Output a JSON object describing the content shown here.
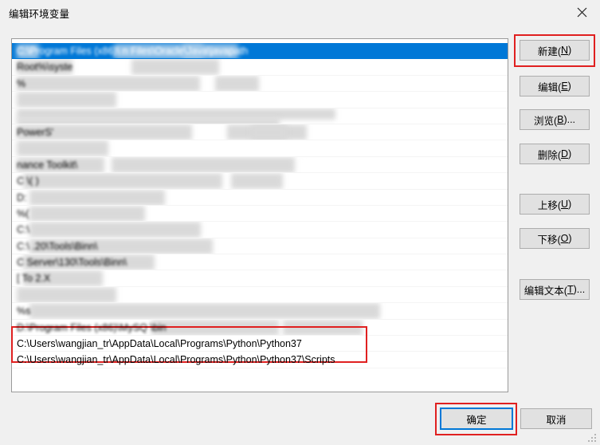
{
  "window": {
    "title": "编辑环境变量",
    "close_icon": "close-icon",
    "close_glyph": "✕"
  },
  "list": {
    "rows": [
      {
        "text": "C:\\Program Files (x86)\\            n Files\\Oracle\\Java\\javapath",
        "selected": true,
        "blur_text": true,
        "redactions": [
          [
            6,
            1,
            28,
            19
          ],
          [
            128,
            1,
            112,
            19
          ],
          [
            214,
            1,
            70,
            19
          ]
        ]
      },
      {
        "text": "            Root%\\syste",
        "selected": false,
        "blur_text": true,
        "redactions": [
          [
            6,
            0,
            70,
            20
          ],
          [
            150,
            0,
            110,
            20
          ]
        ]
      },
      {
        "text": "                       %",
        "selected": false,
        "blur_text": true,
        "redactions": [
          [
            6,
            0,
            230,
            20
          ],
          [
            255,
            0,
            55,
            20
          ]
        ]
      },
      {
        "text": "",
        "selected": false,
        "blur_text": false,
        "redactions": [
          [
            6,
            0,
            125,
            20
          ]
        ]
      },
      {
        "text": "",
        "selected": false,
        "blur_text": false,
        "redactions": [
          [
            6,
            0,
            400,
            14
          ],
          [
            6,
            12,
            330,
            10
          ]
        ]
      },
      {
        "text": "                                                  PowerS'",
        "selected": false,
        "blur_text": true,
        "redactions": [
          [
            6,
            0,
            220,
            20
          ],
          [
            270,
            0,
            100,
            20
          ],
          [
            300,
            0,
            45,
            20
          ]
        ]
      },
      {
        "text": "",
        "selected": false,
        "blur_text": false,
        "redactions": [
          [
            6,
            0,
            115,
            20
          ]
        ]
      },
      {
        "text": "                                                                        nance Toolkit\\",
        "selected": false,
        "blur_text": true,
        "redactions": [
          [
            6,
            0,
            110,
            20
          ],
          [
            125,
            0,
            230,
            20
          ],
          [
            363,
            0,
            1,
            1
          ]
        ]
      },
      {
        "text": "C                                           \\(                  )",
        "selected": false,
        "blur_text": true,
        "redactions": [
          [
            14,
            0,
            250,
            20
          ],
          [
            275,
            0,
            65,
            20
          ]
        ]
      },
      {
        "text": "D:",
        "selected": false,
        "blur_text": true,
        "redactions": [
          [
            22,
            0,
            170,
            20
          ]
        ]
      },
      {
        "text": "%(",
        "selected": false,
        "blur_text": true,
        "redactions": [
          [
            22,
            0,
            145,
            20
          ]
        ]
      },
      {
        "text": "C:\\",
        "selected": false,
        "blur_text": true,
        "redactions": [
          [
            22,
            0,
            215,
            20
          ]
        ]
      },
      {
        "text": "C:\\                                       .20\\Tools\\Binn\\",
        "selected": false,
        "blur_text": true,
        "redactions": [
          [
            22,
            0,
            230,
            20
          ]
        ]
      },
      {
        "text": "C                                 Server\\130\\Tools\\Binn\\",
        "selected": false,
        "blur_text": true,
        "redactions": [
          [
            14,
            0,
            165,
            20
          ]
        ]
      },
      {
        "text": "[                  To              2.X",
        "selected": false,
        "blur_text": true,
        "redactions": [
          [
            14,
            0,
            100,
            20
          ]
        ]
      },
      {
        "text": "",
        "selected": false,
        "blur_text": false,
        "redactions": [
          [
            6,
            0,
            125,
            20
          ]
        ]
      },
      {
        "text": "%s",
        "selected": false,
        "blur_text": true,
        "redactions": [
          [
            22,
            0,
            440,
            20
          ]
        ]
      },
      {
        "text": "D:\\Program Files (x86)\\MySQ                                       \\bin",
        "selected": false,
        "blur_text": true,
        "redactions": [
          [
            175,
            0,
            160,
            20
          ],
          [
            340,
            0,
            100,
            20
          ]
        ]
      },
      {
        "text": "C:\\Users\\wangjian_tr\\AppData\\Local\\Programs\\Python\\Python37",
        "selected": false,
        "blur_text": false,
        "redactions": []
      },
      {
        "text": "C:\\Users\\wangjian_tr\\AppData\\Local\\Programs\\Python\\Python37\\Scripts",
        "selected": false,
        "blur_text": false,
        "redactions": []
      },
      {
        "text": "",
        "selected": false,
        "blur_text": false,
        "redactions": []
      },
      {
        "text": "",
        "selected": false,
        "blur_text": false,
        "redactions": []
      }
    ]
  },
  "buttons": {
    "new": {
      "label": "新建(N)",
      "accel": "N"
    },
    "edit": {
      "label": "编辑(E)",
      "accel": "E"
    },
    "browse": {
      "label": "浏览(B)...",
      "accel": "B"
    },
    "delete": {
      "label": "删除(D)",
      "accel": "D"
    },
    "move_up": {
      "label": "上移(U)",
      "accel": "U"
    },
    "move_down": {
      "label": "下移(O)",
      "accel": "O"
    },
    "edit_text": {
      "label": "编辑文本(T)...",
      "accel": "T"
    },
    "ok": {
      "label": "确定"
    },
    "cancel": {
      "label": "取消"
    }
  },
  "annotations": {
    "color": "#e02020",
    "targets": [
      "new-button",
      "python-path-rows",
      "ok-button"
    ]
  },
  "colors": {
    "accent_selection": "#0078d7",
    "dialog_background": "#f0f0f0",
    "list_background": "#ffffff",
    "button_face": "#e1e1e1",
    "button_border": "#adadad",
    "annotation_red": "#e02020"
  }
}
